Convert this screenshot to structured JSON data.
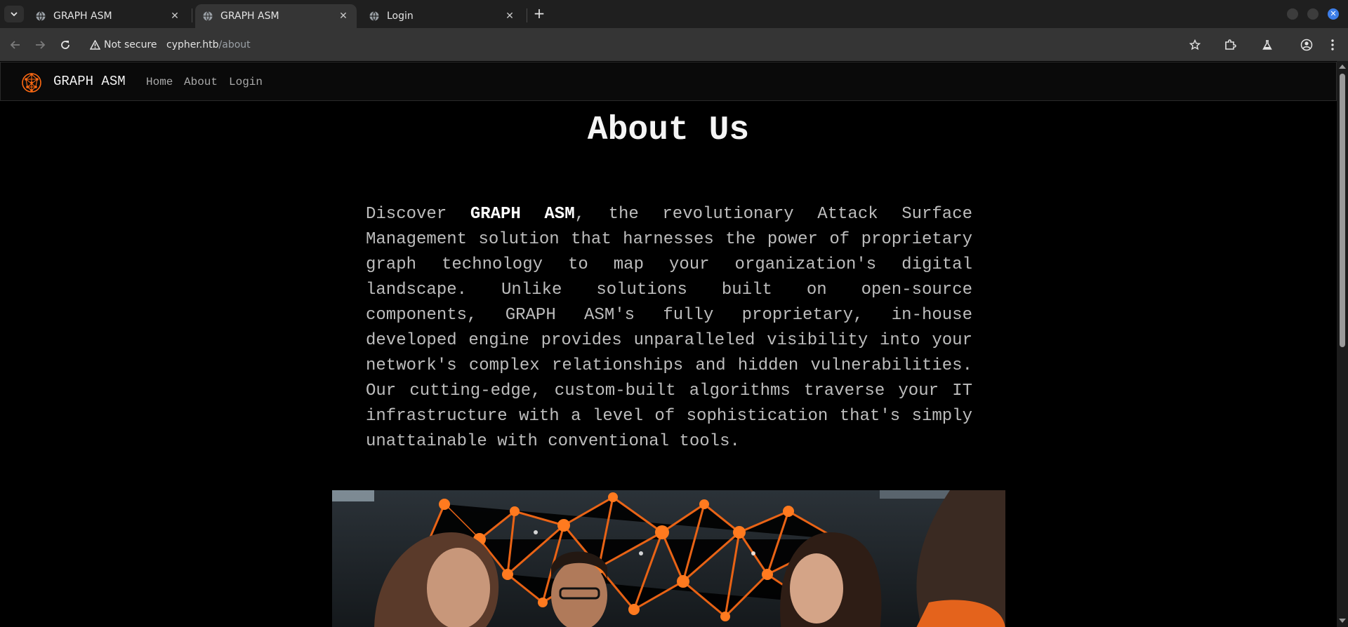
{
  "browser": {
    "tabs": [
      {
        "title": "GRAPH ASM"
      },
      {
        "title": "GRAPH ASM"
      },
      {
        "title": "Login"
      }
    ],
    "security_label": "Not secure",
    "url_host": "cypher.htb",
    "url_path": "/about"
  },
  "site": {
    "brand": "GRAPH ASM",
    "nav": [
      "Home",
      "About",
      "Login"
    ]
  },
  "about": {
    "title": "About Us",
    "intro_before": "Discover ",
    "intro_strong": "GRAPH ASM",
    "intro_after": ", the revolutionary Attack Surface Management solution that harnesses the power of proprietary graph technology to map your organization's digital landscape. Unlike solutions built on open-source components, GRAPH ASM's fully proprietary, in-house developed engine provides unparalleled visibility into your network's complex relationships and hidden vulnerabilities. Our cutting-edge, custom-built algorithms traverse your IT infrastructure with a level of sophistication that's simply unattainable with conventional tools."
  },
  "colors": {
    "accent": "#ff6a13",
    "page_bg": "#000000"
  }
}
